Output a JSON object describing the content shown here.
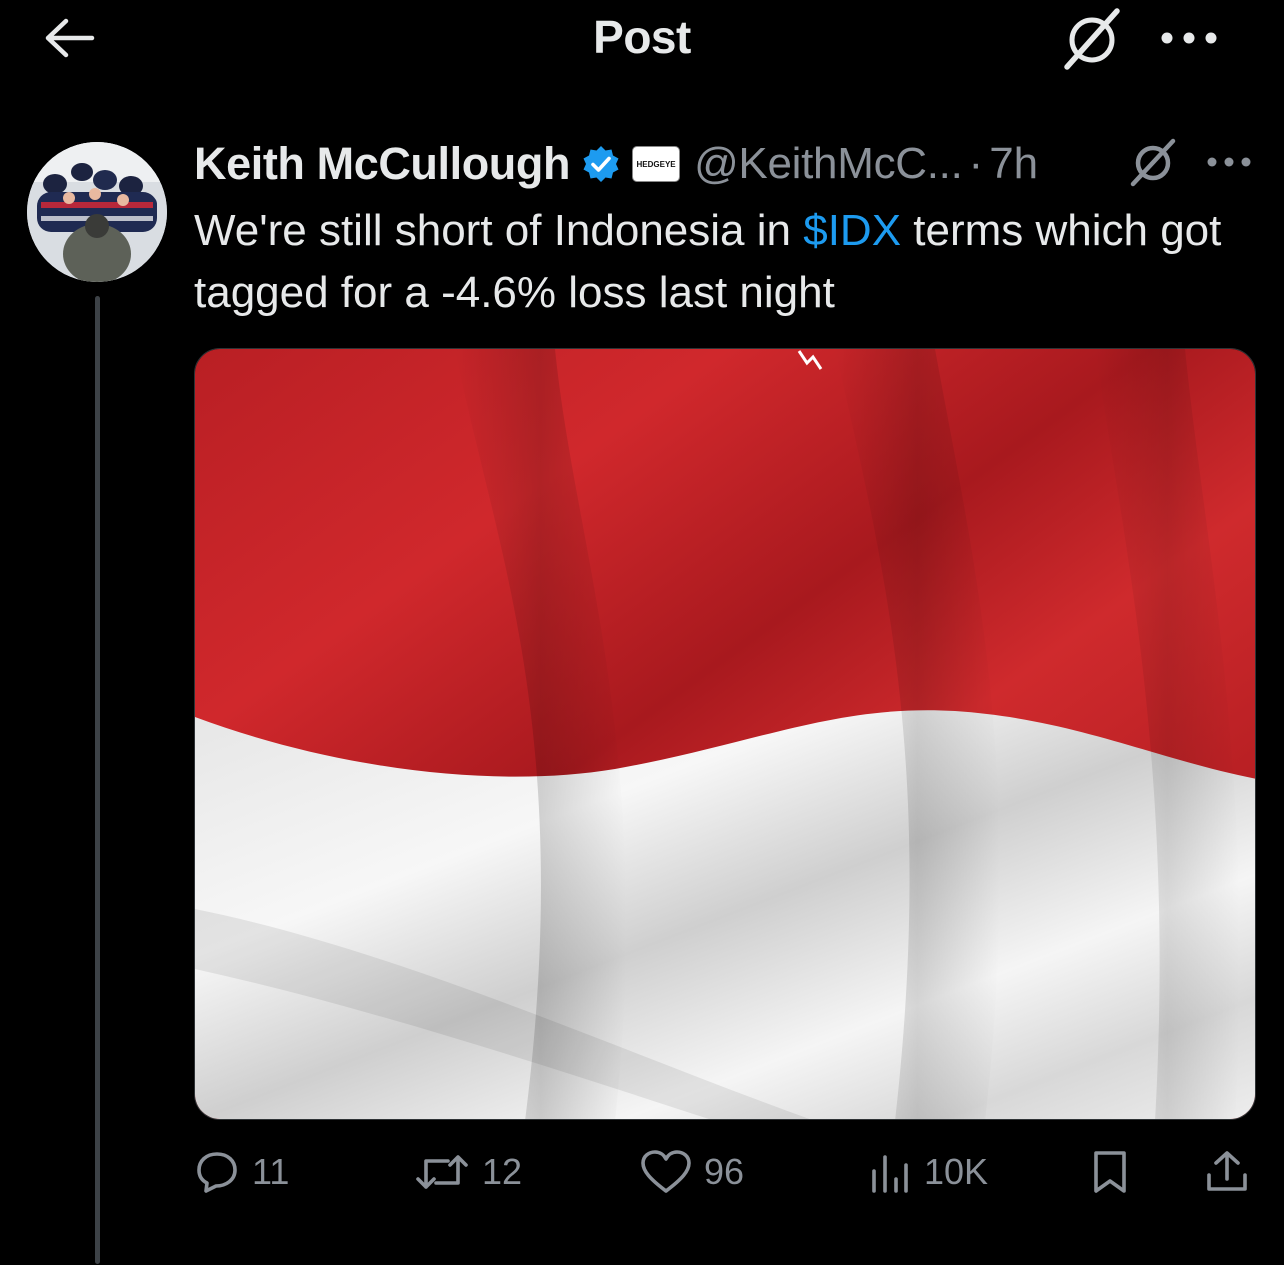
{
  "header": {
    "title": "Post",
    "back_icon": "arrow-left-icon",
    "grok_icon": "grok-icon",
    "more_icon": "more-horizontal-icon"
  },
  "tweet": {
    "display_name": "Keith McCullough",
    "verified": true,
    "affiliate_badge": "HEDGEYE",
    "handle": "@KeithMcC...",
    "separator": "·",
    "time": "7h",
    "text_before": "We're still short of Indonesia in ",
    "cashtag": "$IDX",
    "text_after": " terms which got tagged for a -4.6% loss last night",
    "media": {
      "description_icon": "indonesia-flag-image",
      "colors": {
        "red": "#c8252a",
        "white": "#f2f2f2"
      }
    }
  },
  "actions": {
    "replies": "11",
    "reposts": "12",
    "likes": "96",
    "views": "10K"
  },
  "colors": {
    "background": "#000000",
    "text": "#e7e9ea",
    "muted": "#8b9199",
    "accent": "#1d9bf0",
    "verified": "#1d9bf0"
  }
}
